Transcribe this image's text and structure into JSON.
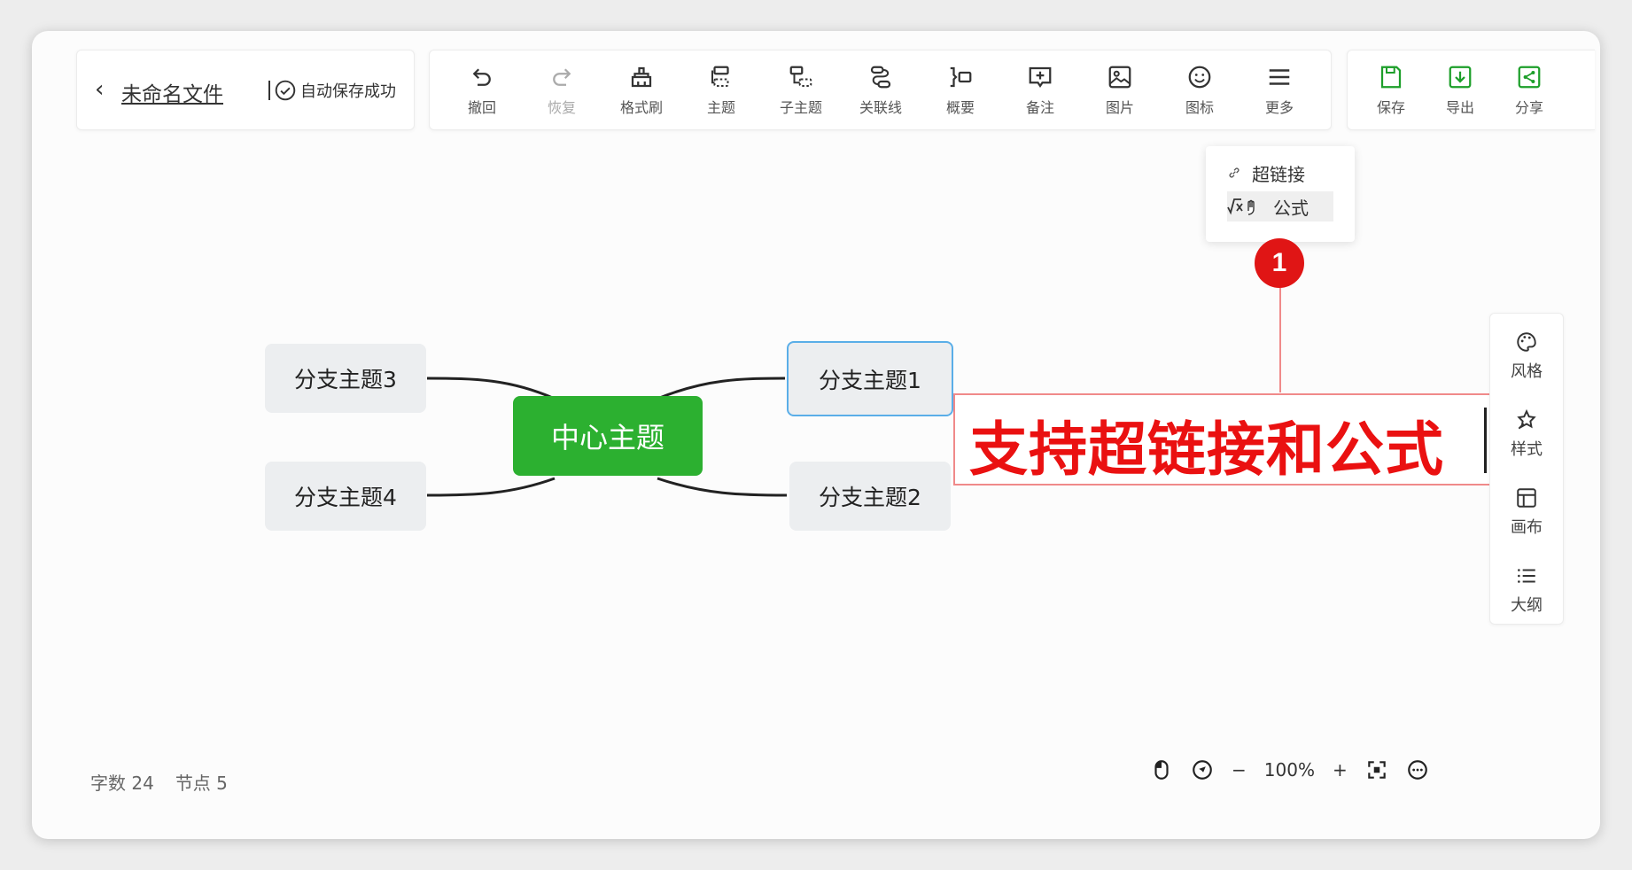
{
  "file": {
    "back_icon": "chevron-left-icon",
    "name": "未命名文件",
    "save_status": "自动保存成功"
  },
  "toolbar": {
    "undo": "撤回",
    "redo": "恢复",
    "format_brush": "格式刷",
    "topic": "主题",
    "subtopic": "子主题",
    "relation": "关联线",
    "summary": "概要",
    "note": "备注",
    "image": "图片",
    "icon": "图标",
    "more": "更多"
  },
  "right_toolbar": {
    "save": "保存",
    "export": "导出",
    "share": "分享"
  },
  "more_menu": {
    "items": [
      "超链接",
      "公式"
    ]
  },
  "callout": {
    "number": "1",
    "text": "支持超链接和公式",
    "color": "#ea1111"
  },
  "mindmap": {
    "center": "中心主题",
    "branches": [
      "分支主题1",
      "分支主题2",
      "分支主题3",
      "分支主题4"
    ],
    "center_color": "#2cb030"
  },
  "side_panel": {
    "items": [
      "风格",
      "样式",
      "画布",
      "大纲"
    ]
  },
  "status": {
    "word_count_label": "字数",
    "word_count": "24",
    "node_count_label": "节点",
    "node_count": "5"
  },
  "zoom": {
    "level": "100%",
    "minus": "−",
    "plus": "+"
  }
}
